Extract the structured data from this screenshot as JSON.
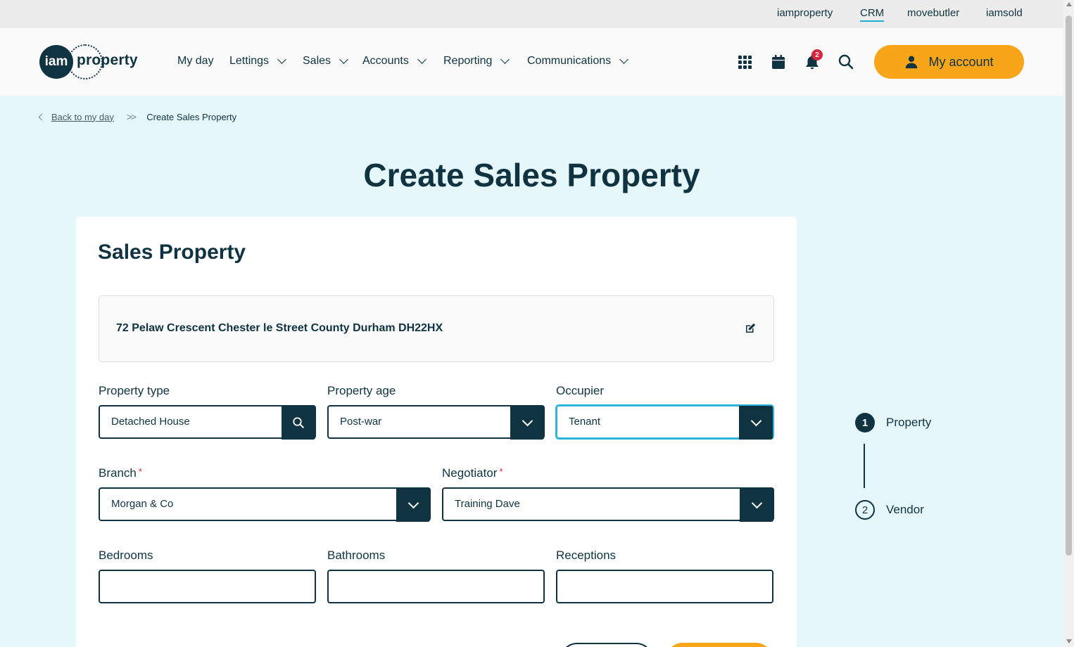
{
  "utility_links": [
    {
      "label": "iamproperty"
    },
    {
      "label": "CRM",
      "active": true
    },
    {
      "label": "movebutler"
    },
    {
      "label": "iamsold"
    }
  ],
  "logo": {
    "circle_text": "iam",
    "word": "property"
  },
  "nav": [
    {
      "label": "My day",
      "has_dropdown": false
    },
    {
      "label": "Lettings",
      "has_dropdown": true
    },
    {
      "label": "Sales",
      "has_dropdown": true
    },
    {
      "label": "Accounts",
      "has_dropdown": true
    },
    {
      "label": "Reporting",
      "has_dropdown": true
    },
    {
      "label": "Communications",
      "has_dropdown": true
    }
  ],
  "header_icons": [
    "apps-grid-icon",
    "calendar-icon",
    "bell-icon",
    "search-icon"
  ],
  "notifications": {
    "count": "2"
  },
  "account_button": {
    "label": "My account",
    "icon": "user-icon"
  },
  "breadcrumb": {
    "back_label": "Back to my day",
    "current": "Create Sales Property"
  },
  "page_title": "Create Sales Property",
  "card": {
    "title": "Sales Property",
    "address": "72 Pelaw Crescent Chester le Street County Durham DH22HX"
  },
  "form": {
    "property_type": {
      "label": "Property type",
      "value": "Detached House"
    },
    "property_age": {
      "label": "Property age",
      "value": "Post-war"
    },
    "occupier": {
      "label": "Occupier",
      "value": "Tenant"
    },
    "branch": {
      "label": "Branch",
      "required": "*",
      "value": "Morgan & Co"
    },
    "negotiator": {
      "label": "Negotiator",
      "required": "*",
      "value": "Training Dave"
    },
    "bedrooms": {
      "label": "Bedrooms",
      "value": ""
    },
    "bathrooms": {
      "label": "Bathrooms",
      "value": ""
    },
    "receptions": {
      "label": "Receptions",
      "value": ""
    }
  },
  "stepper": [
    {
      "number": "1",
      "label": "Property",
      "active": true
    },
    {
      "number": "2",
      "label": "Vendor",
      "active": false
    }
  ],
  "colors": {
    "primary": "#0f3340",
    "accent": "#f9a51a",
    "background": "#e6f7fa",
    "focus": "#2bb6d9",
    "badge": "#d7263d"
  }
}
